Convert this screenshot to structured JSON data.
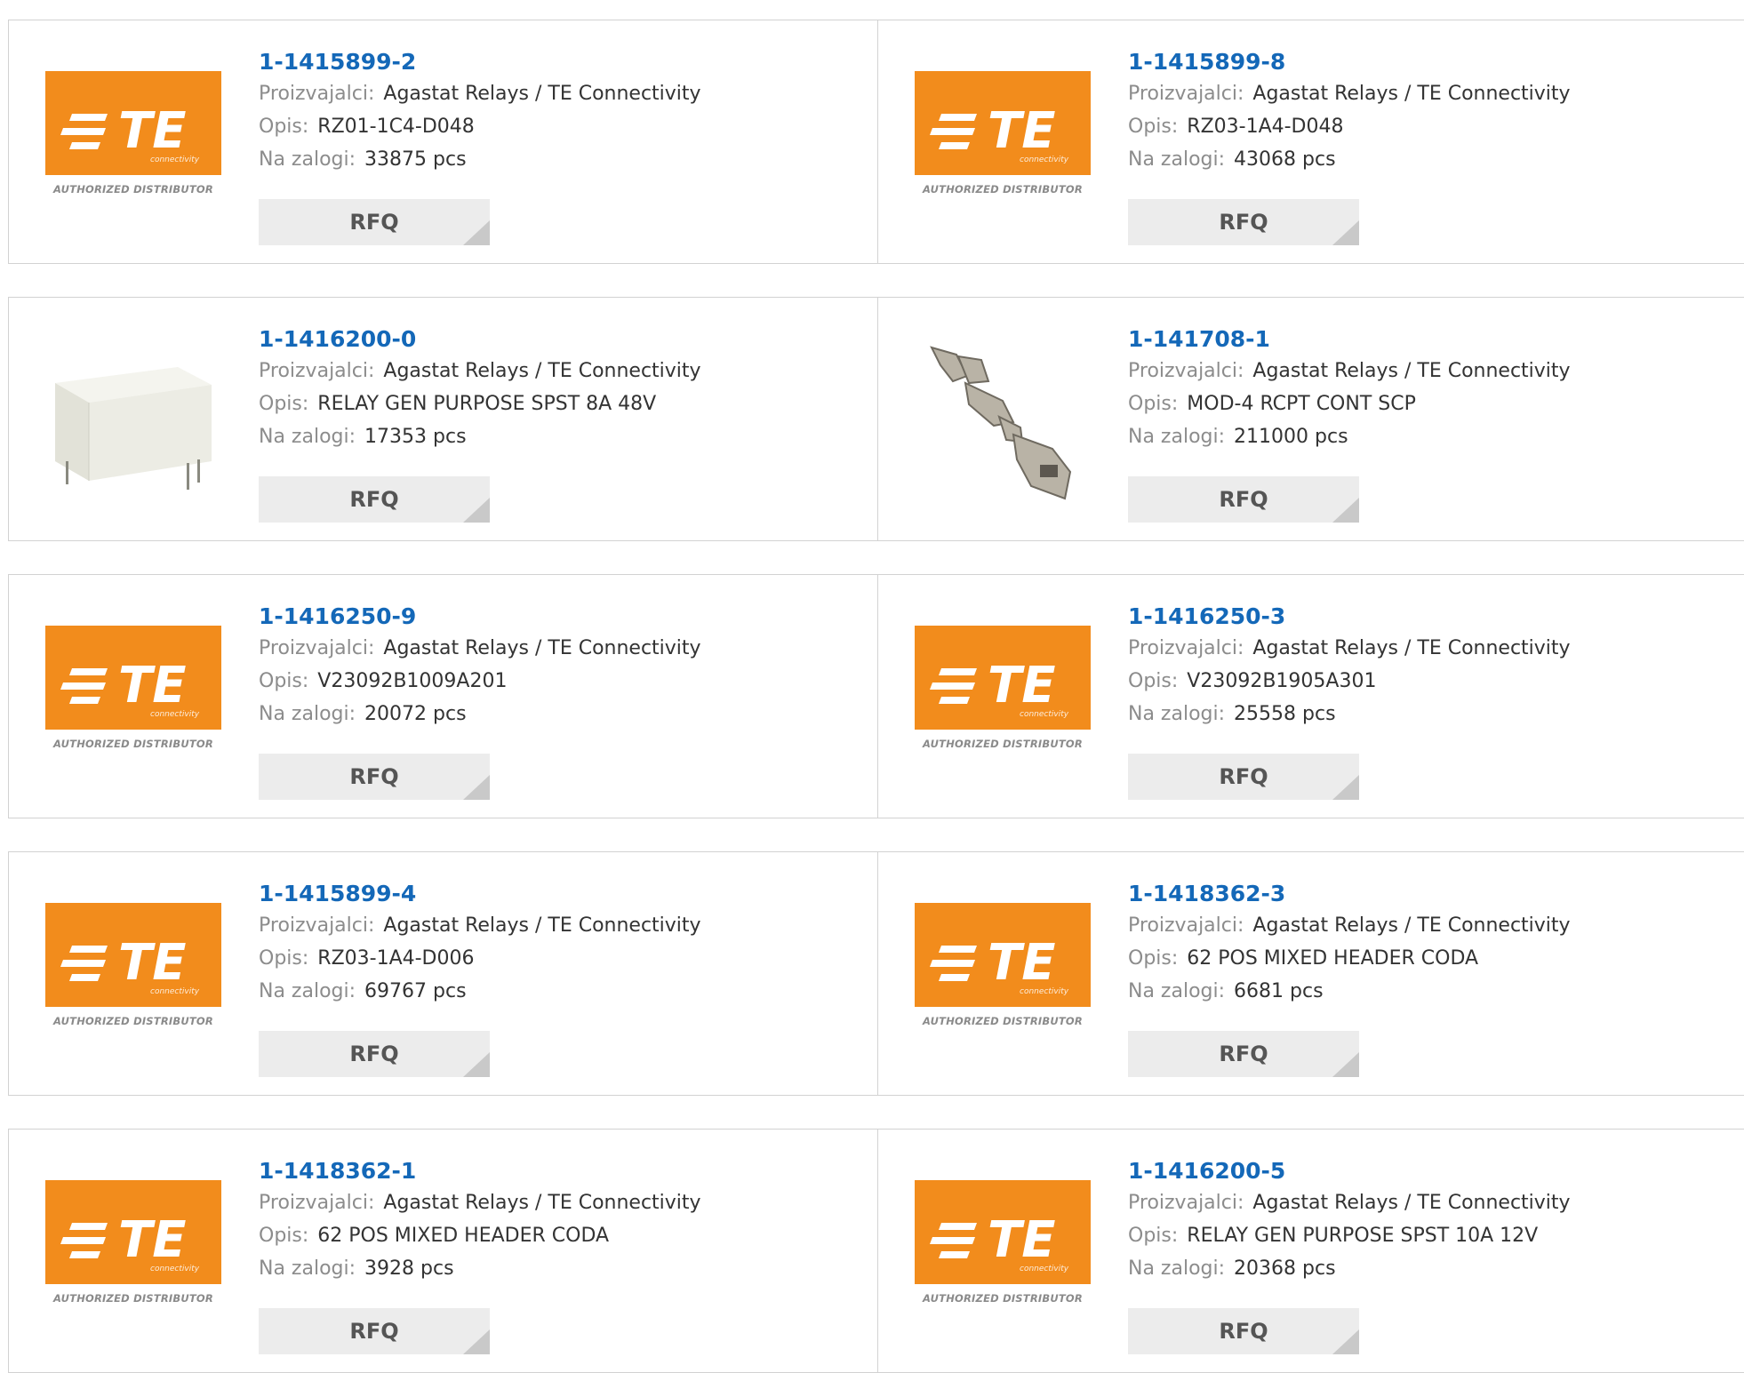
{
  "labels": {
    "manufacturer": "Proizvajalci:",
    "description": "Opis:",
    "stock": "Na zalogi:",
    "rfq": "RFQ",
    "authorized": "AUTHORIZED DISTRIBUTOR",
    "te_text": "TE",
    "te_sub": "connectivity"
  },
  "colors": {
    "part_link": "#1468b8",
    "te_orange": "#f28c1c",
    "rfq_bg": "#ececec"
  },
  "products": [
    {
      "part": "1-1415899-2",
      "manufacturer": "Agastat Relays / TE Connectivity",
      "description": "RZ01-1C4-D048",
      "stock": "33875 pcs",
      "image": "te-logo"
    },
    {
      "part": "1-1415899-8",
      "manufacturer": "Agastat Relays / TE Connectivity",
      "description": "RZ03-1A4-D048",
      "stock": "43068 pcs",
      "image": "te-logo"
    },
    {
      "part": "1-1416200-0",
      "manufacturer": "Agastat Relays / TE Connectivity",
      "description": "RELAY GEN PURPOSE SPST 8A 48V",
      "stock": "17353 pcs",
      "image": "relay-photo"
    },
    {
      "part": "1-141708-1",
      "manufacturer": "Agastat Relays / TE Connectivity",
      "description": "MOD-4 RCPT CONT SCP",
      "stock": "211000 pcs",
      "image": "contact-photo"
    },
    {
      "part": "1-1416250-9",
      "manufacturer": "Agastat Relays / TE Connectivity",
      "description": "V23092B1009A201",
      "stock": "20072 pcs",
      "image": "te-logo"
    },
    {
      "part": "1-1416250-3",
      "manufacturer": "Agastat Relays / TE Connectivity",
      "description": "V23092B1905A301",
      "stock": "25558 pcs",
      "image": "te-logo"
    },
    {
      "part": "1-1415899-4",
      "manufacturer": "Agastat Relays / TE Connectivity",
      "description": "RZ03-1A4-D006",
      "stock": "69767 pcs",
      "image": "te-logo"
    },
    {
      "part": "1-1418362-3",
      "manufacturer": "Agastat Relays / TE Connectivity",
      "description": "62 POS MIXED HEADER CODA",
      "stock": "6681 pcs",
      "image": "te-logo"
    },
    {
      "part": "1-1418362-1",
      "manufacturer": "Agastat Relays / TE Connectivity",
      "description": "62 POS MIXED HEADER CODA",
      "stock": "3928 pcs",
      "image": "te-logo"
    },
    {
      "part": "1-1416200-5",
      "manufacturer": "Agastat Relays / TE Connectivity",
      "description": "RELAY GEN PURPOSE SPST 10A 12V",
      "stock": "20368 pcs",
      "image": "te-logo"
    }
  ]
}
